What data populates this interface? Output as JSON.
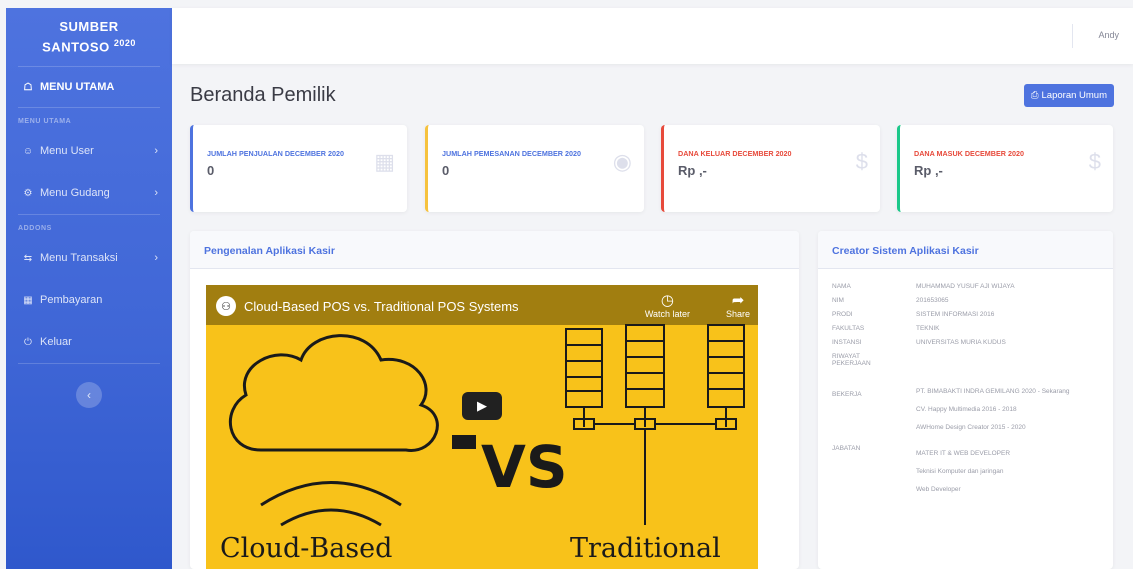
{
  "brand": {
    "line1": "SUMBER",
    "line2": "SANTOSO",
    "year": "2020"
  },
  "sidebar": {
    "main": {
      "icon": "home-icon",
      "label": "MENU UTAMA"
    },
    "heading1": "MENU UTAMA",
    "items1": [
      {
        "icon": "user-icon",
        "label": "Menu User",
        "chevron": "›"
      },
      {
        "icon": "warehouse-icon",
        "label": "Menu Gudang",
        "chevron": "›"
      }
    ],
    "heading2": "ADDONS",
    "items2": [
      {
        "icon": "transaction-icon",
        "label": "Menu Transaksi",
        "chevron": "›"
      },
      {
        "icon": "payment-icon",
        "label": "Pembayaran"
      },
      {
        "icon": "power-icon",
        "label": "Keluar"
      }
    ],
    "toggle": "‹"
  },
  "topbar": {
    "user": "Andy"
  },
  "page": {
    "title": "Beranda Pemilik",
    "report_button": "Laporan Umum"
  },
  "cards": [
    {
      "label": "JUMLAH PENJUALAN DECEMBER 2020",
      "value": "0",
      "icon": "calendar-icon",
      "color": "#4e73df"
    },
    {
      "label": "JUMLAH PEMESANAN DECEMBER 2020",
      "value": "0",
      "icon": "comments-icon",
      "color": "#f6c23e"
    },
    {
      "label": "DANA KELUAR DECEMBER 2020",
      "value": "Rp ,-",
      "icon": "dollar-icon",
      "color": "#e74a3b"
    },
    {
      "label": "DANA MASUK DECEMBER 2020",
      "value": "Rp ,-",
      "icon": "dollar-icon",
      "color": "#1cc88a"
    }
  ],
  "left_panel": {
    "title": "Pengenalan Aplikasi Kasir",
    "video": {
      "title": "Cloud-Based POS vs. Traditional POS Systems",
      "watch_later": "Watch later",
      "share": "Share",
      "left_text": "Cloud-Based",
      "right_text": "Traditional",
      "vs": "VS"
    }
  },
  "right_panel": {
    "title": "Creator Sistem Aplikasi Kasir",
    "rows": [
      {
        "key": "NAMA",
        "values": [
          "MUHAMMAD YUSUF AJI WIJAYA"
        ]
      },
      {
        "key": "NIM",
        "values": [
          "201653065"
        ]
      },
      {
        "key": "PRODI",
        "values": [
          "SISTEM INFORMASI 2016"
        ]
      },
      {
        "key": "FAKULTAS",
        "values": [
          "TEKNIK"
        ]
      },
      {
        "key": "INSTANSI",
        "values": [
          "UNIVERSITAS MURIA KUDUS"
        ]
      },
      {
        "key": "RIWAYAT PEKERJAAN",
        "values": [
          ""
        ]
      },
      {
        "key": "BEKERJA",
        "values": [
          "PT. BIMABAKTI INDRA GEMILANG 2020 - Sekarang",
          "CV. Happy Multimedia 2016 - 2018",
          "AWHome Design Creator 2015 - 2020"
        ]
      },
      {
        "key": "JABATAN",
        "values": [
          "MATER IT & WEB DEVELOPER",
          "Teknisi Komputer dan jaringan",
          "Web Developer"
        ]
      }
    ]
  }
}
